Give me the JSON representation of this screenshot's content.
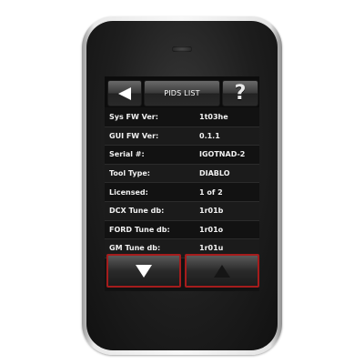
{
  "header": {
    "title": "PIDS LIST",
    "back_icon": "back-arrow-icon",
    "help_label": "?"
  },
  "rows": [
    {
      "label": "Sys FW Ver:",
      "value": "1t03he"
    },
    {
      "label": "GUI FW Ver:",
      "value": "0.1.1"
    },
    {
      "label": "Serial #:",
      "value": "IGOTNAD-2"
    },
    {
      "label": "Tool Type:",
      "value": "DIABLO"
    },
    {
      "label": "Licensed:",
      "value": "1 of 2"
    },
    {
      "label": "DCX Tune db:",
      "value": "1r01b"
    },
    {
      "label": "FORD Tune db:",
      "value": "1r01o"
    },
    {
      "label": "GM Tune db:",
      "value": "1r01u"
    }
  ],
  "footer": {
    "down_icon": "triangle-down-icon",
    "up_icon": "triangle-up-icon"
  },
  "colors": {
    "accent_border": "#a51c1c",
    "screen_bg": "#121212",
    "text": "#f2f2f2"
  }
}
